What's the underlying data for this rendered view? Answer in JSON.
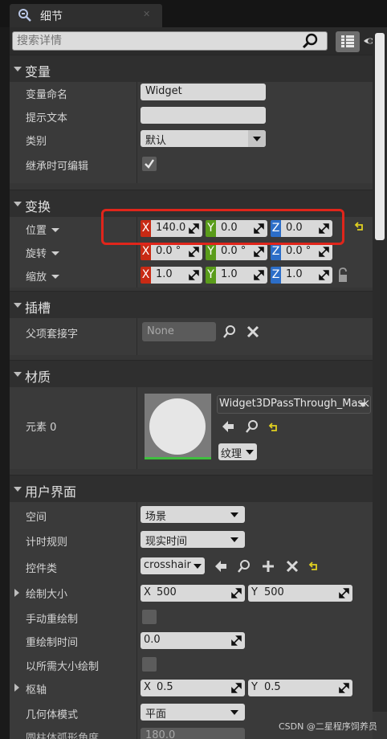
{
  "tab": {
    "title": "细节",
    "close": "✕"
  },
  "search": {
    "placeholder": "搜索详情"
  },
  "sections": {
    "variable": "变量",
    "transform": "变换",
    "socket": "插槽",
    "material": "材质",
    "ui": "用户界面"
  },
  "variable": {
    "name_label": "变量命名",
    "name_value": "Widget",
    "tooltip_label": "提示文本",
    "tooltip_value": "",
    "category_label": "类别",
    "category_value": "默认",
    "editable_label": "继承时可编辑",
    "editable_checked": true
  },
  "transform": {
    "location_label": "位置",
    "rotation_label": "旋转",
    "scale_label": "缩放",
    "axis_x": "X",
    "axis_y": "Y",
    "axis_z": "Z",
    "location": {
      "x": "140.0",
      "y": "0.0",
      "z": "0.0"
    },
    "rotation": {
      "x": "0.0 °",
      "y": "0.0 °",
      "z": "0.0 °"
    },
    "scale": {
      "x": "1.0",
      "y": "1.0",
      "z": "1.0"
    }
  },
  "socket": {
    "parent_label": "父项套接字",
    "parent_value": "None"
  },
  "material": {
    "element_label": "元素 0",
    "material_name": "Widget3DPassThrough_Mask",
    "texture_button": "纹理"
  },
  "ui": {
    "space_label": "空间",
    "space_value": "场景",
    "timing_label": "计时规则",
    "timing_value": "现实时间",
    "widget_class_label": "控件类",
    "widget_class_value": "crosshair",
    "draw_size_label": "绘制大小",
    "draw_size": {
      "x_label": "X",
      "x": "500",
      "y_label": "Y",
      "y": "500"
    },
    "manual_redraw_label": "手动重绘制",
    "redraw_time_label": "重绘制时间",
    "redraw_time_value": "0.0",
    "draw_desired_label": "以所需大小绘制",
    "pivot_label": "枢轴",
    "pivot": {
      "x_label": "X",
      "x": "0.5",
      "y_label": "Y",
      "y": "0.5"
    },
    "geometry_mode_label": "几何体模式",
    "geometry_mode_value": "平面",
    "cylinder_arc_label": "圆柱体弧形角度",
    "cylinder_arc_value": "180.0"
  },
  "watermark": "CSDN @二星程序饲养员",
  "colors": {
    "axis_x": "#c82a14",
    "axis_y": "#5a9c1a",
    "axis_z": "#2c6ec8",
    "highlight": "#e0251b"
  }
}
